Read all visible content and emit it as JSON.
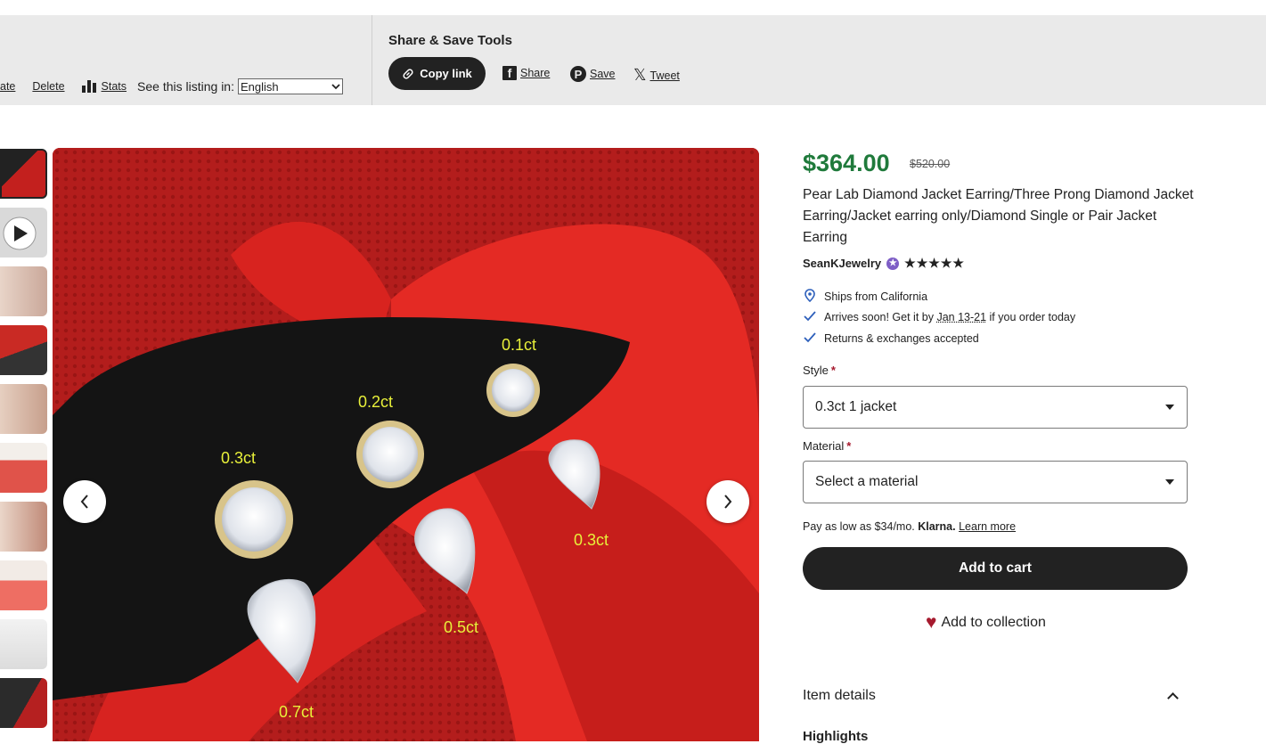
{
  "toolbar": {
    "edit_link": "ate",
    "delete_link": "Delete",
    "stats_link": "Stats",
    "see_listing_label": "See this listing in:",
    "language_selected": "English",
    "share_tools_title": "Share & Save Tools",
    "copy_link_label": "Copy link",
    "facebook_label": "Share",
    "pinterest_label": "Save",
    "x_label": "Tweet"
  },
  "gallery": {
    "image_labels": [
      "0.1ct",
      "0.2ct",
      "0.3ct",
      "0.3ct",
      "0.5ct",
      "0.7ct"
    ]
  },
  "product": {
    "price": "$364.00",
    "original_price": "$520.00",
    "title": "Pear Lab Diamond Jacket Earring/Three Prong Diamond Jacket Earring/Jacket earring only/Diamond Single or Pair Jacket Earring",
    "shop_name": "SeanKJewelry",
    "rating_stars": "★★★★★",
    "rating": 5,
    "ships_from": "Ships from California",
    "arrives_prefix": "Arrives soon! Get it by ",
    "arrives_date": "Jan 13-21",
    "arrives_suffix": " if you order today",
    "returns": "Returns & exchanges accepted",
    "style_label": "Style",
    "style_value": "0.3ct 1 jacket",
    "material_label": "Material",
    "material_value": "Select a material",
    "required_mark": "*",
    "klarna_prefix": "Pay as low as $34/mo. ",
    "klarna_brand": "Klarna.",
    "klarna_learn": "Learn more",
    "add_to_cart": "Add to cart",
    "add_to_collection": "Add to collection",
    "item_details": "Item details",
    "highlights": "Highlights"
  },
  "colors": {
    "price_green": "#1f7a3b",
    "dark": "#222222",
    "heart_red": "#a61a2e",
    "check_blue": "#2d5fbb"
  }
}
